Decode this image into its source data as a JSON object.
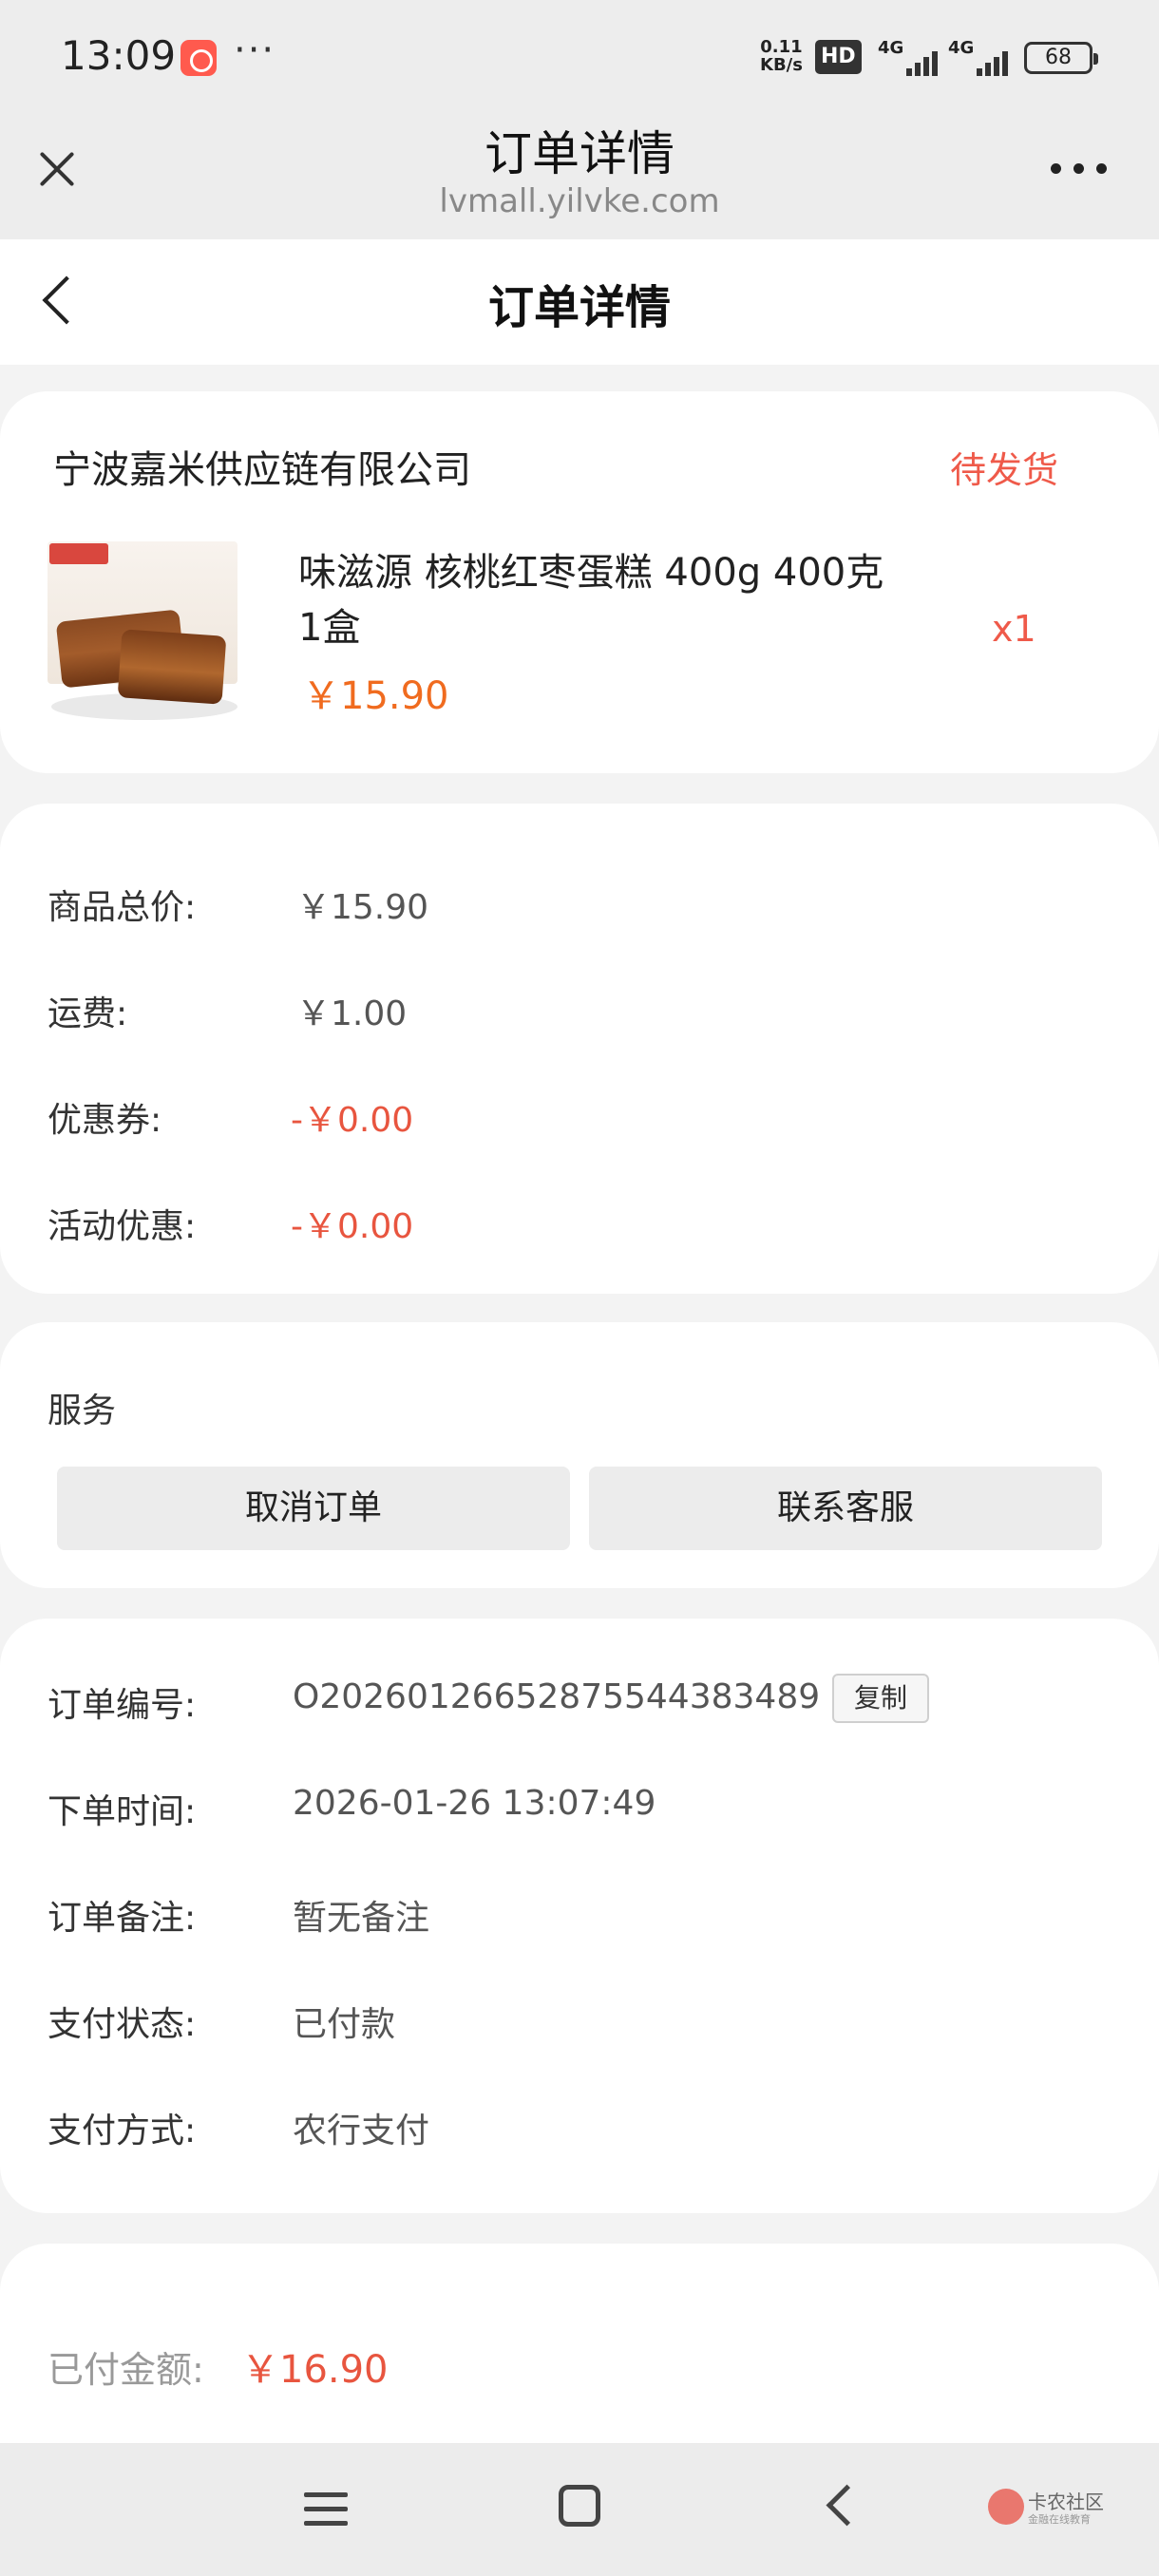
{
  "status_bar": {
    "time": "13:09",
    "more": "···",
    "speed_value": "0.11",
    "speed_unit": "KB/s",
    "hd_badge": "HD",
    "network_1": "4G",
    "network_2": "4G",
    "battery": "68"
  },
  "browser": {
    "title": "订单详情",
    "url": "lvmall.yilvke.com"
  },
  "nav": {
    "title": "订单详情"
  },
  "shop": {
    "name": "宁波嘉米供应链有限公司",
    "status": "待发货",
    "product": {
      "title": "味滋源 核桃红枣蛋糕 400g 400克 1盒",
      "price": "￥15.90",
      "quantity": "x1"
    }
  },
  "price_summary": {
    "rows": [
      {
        "label": "商品总价:",
        "value": "￥15.90"
      },
      {
        "label": "运费:",
        "value": "￥1.00"
      },
      {
        "label": "优惠券:",
        "value": "-￥0.00"
      },
      {
        "label": "活动优惠:",
        "value": "-￥0.00"
      }
    ]
  },
  "service": {
    "label": "服务",
    "cancel_label": "取消订单",
    "contact_label": "联系客服"
  },
  "order_info": {
    "rows": [
      {
        "label": "订单编号:",
        "value": "O202601266528755443834​89"
      },
      {
        "label": "下单时间:",
        "value": "2026-01-26 13:07:49"
      },
      {
        "label": "订单备注:",
        "value": "暂无备注"
      },
      {
        "label": "支付状态:",
        "value": "已付款"
      },
      {
        "label": "支付方式:",
        "value": "农行支付"
      }
    ],
    "copy_label": "复制"
  },
  "paid": {
    "label": "已付金额:",
    "value": "￥16.90"
  },
  "watermark": {
    "text": "卡农社区",
    "sub": "金融在线教育"
  },
  "colors": {
    "accent_red": "#ef5a4a",
    "price_orange": "#f06b1f",
    "background": "#f3f3f3"
  }
}
